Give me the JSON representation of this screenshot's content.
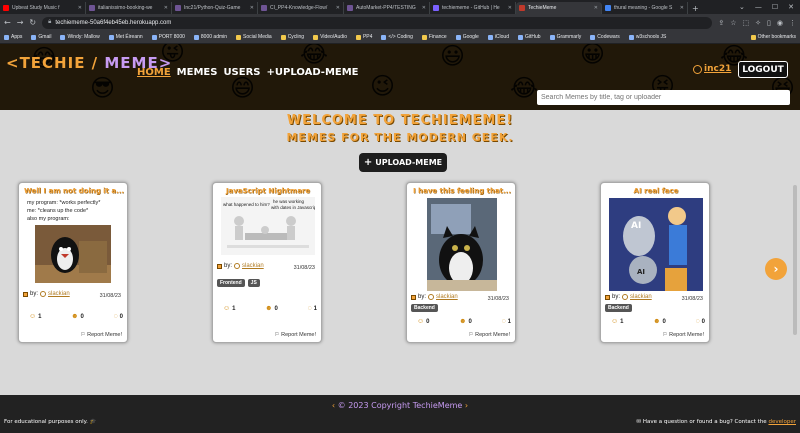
{
  "browser": {
    "tabs": [
      {
        "label": "Upbeat Study Music f",
        "color": "#ff0000"
      },
      {
        "label": "italianissimo-booking-we",
        "color": "#6e5494"
      },
      {
        "label": "Inc21/Python-Quiz-Game",
        "color": "#6e5494"
      },
      {
        "label": "CI_PP4-Knowledge-Flow/",
        "color": "#6e5494"
      },
      {
        "label": "AutoMarket-PP4/TESTING",
        "color": "#6e5494"
      },
      {
        "label": "techiememe - GitHub | He",
        "color": "#7b61ff"
      },
      {
        "label": "TechieMeme",
        "color": "#222222"
      },
      {
        "label": "thural meaning - Google S",
        "color": "#4285f4"
      }
    ],
    "url": "techiememe-50a6f4eb45eb.herokuapp.com",
    "bookmarks": [
      {
        "label": "Apps",
        "folder": false
      },
      {
        "label": "Gmail",
        "folder": false
      },
      {
        "label": "Windy: Mallow",
        "folder": false
      },
      {
        "label": "Met Éireann",
        "folder": false
      },
      {
        "label": "PORT 8000",
        "folder": false
      },
      {
        "label": "8000 admin",
        "folder": false
      },
      {
        "label": "Social Media",
        "folder": true
      },
      {
        "label": "Cycling",
        "folder": true
      },
      {
        "label": "Video/Audio",
        "folder": true
      },
      {
        "label": "PP4",
        "folder": true
      },
      {
        "label": "</> Coding",
        "folder": false
      },
      {
        "label": "Finance",
        "folder": true
      },
      {
        "label": "Google",
        "folder": false
      },
      {
        "label": "iCloud",
        "folder": false
      },
      {
        "label": "GitHub",
        "folder": false
      },
      {
        "label": "Grammarly",
        "folder": false
      },
      {
        "label": "Codewars",
        "folder": false
      },
      {
        "label": "w3schools JS",
        "folder": false
      }
    ],
    "other_bookmarks": "Other bookmarks"
  },
  "header": {
    "logo_left": "<TECHIE /",
    "logo_right": " MEME>",
    "nav": {
      "home": "HOME",
      "memes": "MEMES",
      "users": "USERS",
      "upload": "+UPLOAD-MEME"
    },
    "username": "inc21",
    "logout": "LOGOUT",
    "search_placeholder": "Search Memes by title, tag or uploader"
  },
  "main": {
    "welcome": "WELCOME TO TECHIEMEME!",
    "subtitle": "MEMES FOR THE MODERN GEEK.",
    "upload_button": "UPLOAD-MEME"
  },
  "cards": [
    {
      "title": "Well I am not doing it a...",
      "text1": "my program: *works perfectly*",
      "text2": "me: *cleans up the code*",
      "text3": "also my program:",
      "by": "by:",
      "author": "slackian",
      "date": "31/08/23",
      "tags": [],
      "likes": "1",
      "laughs": "0",
      "comments": "0",
      "report": "Report Meme!"
    },
    {
      "title": "JavaScript Nightmare",
      "img_text1": "what happened to him?",
      "img_text2": "he was working with dates in Javascript",
      "by": "by:",
      "author": "slackian",
      "date": "31/08/23",
      "tags": [
        "Frontend",
        "JS"
      ],
      "likes": "1",
      "laughs": "0",
      "comments": "1",
      "report": "Report Meme!"
    },
    {
      "title": "I have this feeling that...",
      "by": "by:",
      "author": "slackian",
      "date": "31/08/23",
      "tags": [
        "Backend"
      ],
      "likes": "0",
      "laughs": "0",
      "comments": "1",
      "report": "Report Meme!"
    },
    {
      "title": "AI real face",
      "img_text1": "AI",
      "by": "by:",
      "author": "slackian",
      "date": "31/08/23",
      "tags": [
        "Backend"
      ],
      "likes": "1",
      "laughs": "0",
      "comments": "0",
      "report": "Report Meme!"
    }
  ],
  "footer": {
    "copyright": "© 2023 Copyright TechieMeme",
    "edu": "For educational purposes only. 🎓",
    "contact": "✉ Have a question or found a bug? Contact the ",
    "developer": "developer"
  }
}
